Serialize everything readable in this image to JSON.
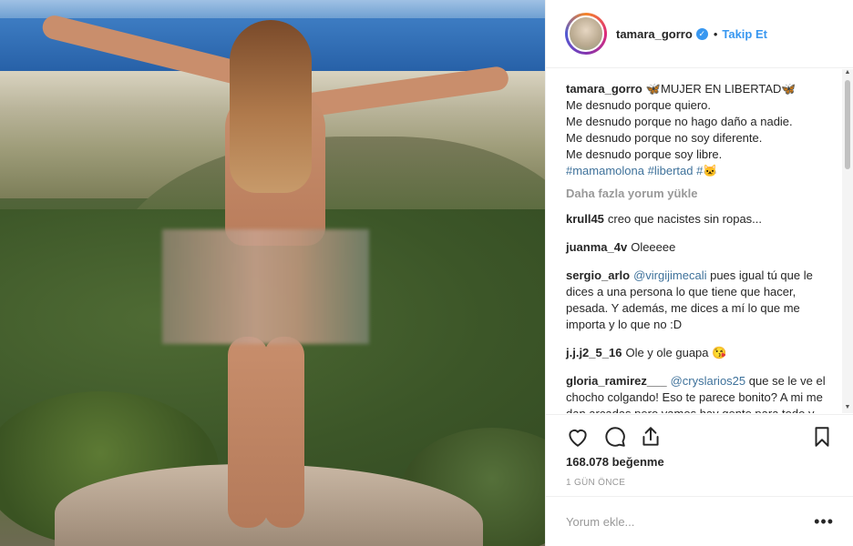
{
  "post": {
    "image_alt": "",
    "username": "tamara_gorro",
    "verified_icon": "verified-badge-icon",
    "separator": "•",
    "follow_label": "Takip Et"
  },
  "caption": {
    "username": "tamara_gorro",
    "lines": [
      "🦋MUJER EN LIBERTAD🦋",
      "Me desnudo porque quiero.",
      "Me desnudo porque no hago daño a nadie.",
      "Me desnudo porque no soy diferente.",
      "Me desnudo porque soy libre.",
      "#mamamolona #libertad #🐱"
    ]
  },
  "load_more": "Daha fazla yorum yükle",
  "comments": [
    {
      "user": "krull45",
      "mention": "",
      "text": "creo que nacistes sin ropas..."
    },
    {
      "user": "juanma_4v",
      "mention": "",
      "text": "Oleeeee"
    },
    {
      "user": "sergio_arlo",
      "mention": "@virgijimecali",
      "text": "pues igual tú que le dices a una persona lo que tiene que hacer, pesada. Y además, me dices a mí lo que me importa y lo que no :D"
    },
    {
      "user": "j.j.j2_5_16",
      "mention": "",
      "text": "Ole y ole guapa 😘"
    },
    {
      "user": "gloria_ramirez___",
      "mention": "@cryslarios25",
      "text": "que se le ve el chocho colgando! Eso te parece bonito? A mi me dan arcadas pero vamos hay gente para todo y para todos, a las"
    }
  ],
  "likes": "168.078 beğenme",
  "timestamp": "1 GÜN ÖNCE",
  "comment_input": {
    "placeholder": "Yorum ekle..."
  },
  "more_options": "•••",
  "colors": {
    "accent": "#3897f0",
    "text": "#262626",
    "muted": "#999999",
    "mention": "#3f729b"
  },
  "icons": [
    "heart-icon",
    "comment-icon",
    "share-icon",
    "bookmark-icon"
  ]
}
